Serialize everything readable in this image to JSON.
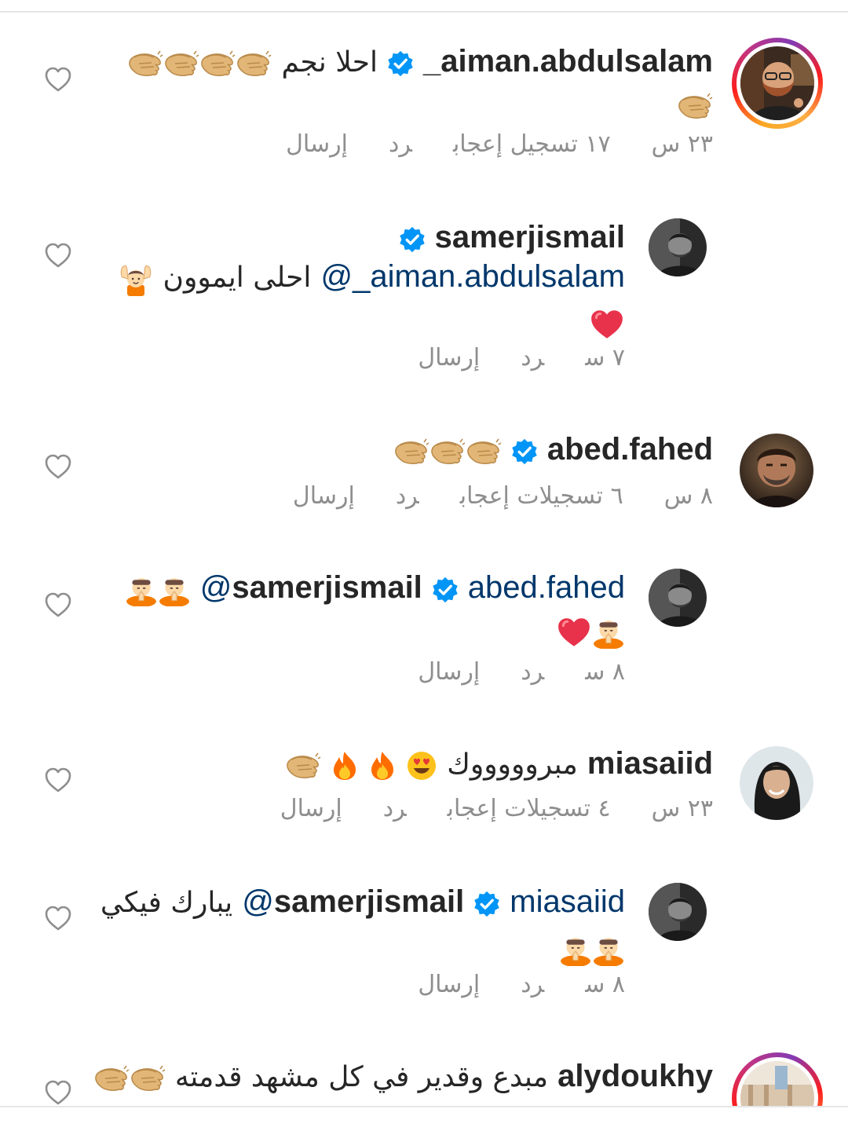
{
  "comments": [
    {
      "username": "aiman.abdulsalam_",
      "verified": true,
      "text": "احلا نجم",
      "time": "٢٣ س",
      "likes": "١٧ تسجيل إعجاب",
      "reply": "رد",
      "send": "إرسال"
    },
    {
      "username": "samerjismail",
      "verified": true,
      "mention": "aiman.abdulsalam_@",
      "text": "احلى ايموون",
      "time": "٧ س",
      "reply": "رد",
      "send": "إرسال"
    },
    {
      "username": "abed.fahed",
      "verified": true,
      "time": "٨ س",
      "likes": "٦ تسجيلات إعجاب",
      "reply": "رد",
      "send": "إرسال"
    },
    {
      "username": "samerjismail",
      "verified": true,
      "mention": "abed.fahed@",
      "time": "٨ س",
      "reply": "رد",
      "send": "إرسال"
    },
    {
      "username": "miasaiid",
      "verified": false,
      "text": "مبروووووك",
      "time": "٢٣ س",
      "likes": "٤ تسجيلات إعجاب",
      "reply": "رد",
      "send": "إرسال"
    },
    {
      "username": "samerjismail",
      "verified": true,
      "mention": "miasaiid@",
      "text": "يبارك فيكي",
      "time": "٨ س",
      "reply": "رد",
      "send": "إرسال"
    },
    {
      "username": "alydoukhy",
      "verified": false,
      "text": "مبدع وقدير في كل مشهد قدمته"
    }
  ],
  "icons": {
    "heart": "heart-outline-icon",
    "verified": "verified-badge-icon",
    "clap": "clapping-hands-emoji",
    "fire": "fire-emoji",
    "heart_eyes": "heart-eyes-emoji",
    "red_heart": "red-heart-emoji",
    "bow": "person-bowing-emoji",
    "raising_hands": "person-raising-hands-emoji"
  },
  "colors": {
    "text": "#262626",
    "meta": "#8e8e8e",
    "mention": "#00376b",
    "verified": "#0095f6"
  }
}
